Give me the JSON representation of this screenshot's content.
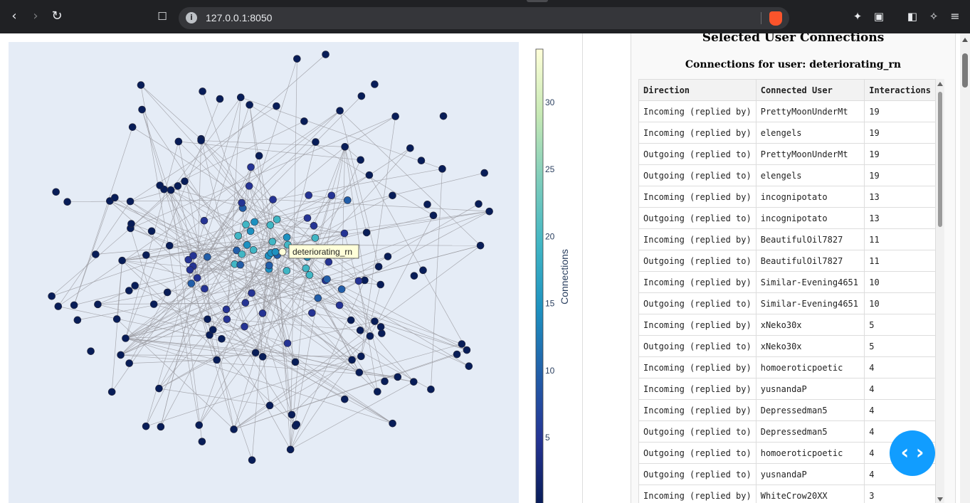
{
  "browser": {
    "url": "127.0.0.1:8050",
    "icons": [
      "back-icon",
      "forward-icon",
      "reload-icon",
      "bookmark-icon",
      "site-info-icon",
      "brave-shield-icon",
      "extensions-icon",
      "screenshot-icon",
      "sidebar-icon",
      "leo-icon",
      "menu-icon"
    ]
  },
  "graph": {
    "hover_label": "deteriorating_rn",
    "colorbar_title": "Connections",
    "colorbar_ticks": [
      "30",
      "25",
      "20",
      "15",
      "10",
      "5"
    ],
    "colorscale": [
      "#ffffd9",
      "#c7e9b4",
      "#7fcdbb",
      "#41b6c4",
      "#1d91c0",
      "#225ea8",
      "#253494",
      "#081d58"
    ]
  },
  "panel": {
    "title": "Selected User Connections",
    "subtitle": "Connections for user: deteriorating_rn",
    "columns": [
      "Direction",
      "Connected User",
      "Interactions"
    ],
    "rows": [
      [
        "Incoming (replied by)",
        "PrettyMoonUnderMt",
        "19"
      ],
      [
        "Incoming (replied by)",
        "elengels",
        "19"
      ],
      [
        "Outgoing (replied to)",
        "PrettyMoonUnderMt",
        "19"
      ],
      [
        "Outgoing (replied to)",
        "elengels",
        "19"
      ],
      [
        "Incoming (replied by)",
        "incognipotato",
        "13"
      ],
      [
        "Outgoing (replied to)",
        "incognipotato",
        "13"
      ],
      [
        "Incoming (replied by)",
        "BeautifulOil7827",
        "11"
      ],
      [
        "Outgoing (replied to)",
        "BeautifulOil7827",
        "11"
      ],
      [
        "Incoming (replied by)",
        "Similar-Evening4651",
        "10"
      ],
      [
        "Outgoing (replied to)",
        "Similar-Evening4651",
        "10"
      ],
      [
        "Incoming (replied by)",
        "xNeko30x",
        "5"
      ],
      [
        "Outgoing (replied to)",
        "xNeko30x",
        "5"
      ],
      [
        "Incoming (replied by)",
        "homoeroticpoetic",
        "4"
      ],
      [
        "Incoming (replied by)",
        "yusnandaP",
        "4"
      ],
      [
        "Incoming (replied by)",
        "Depressedman5",
        "4"
      ],
      [
        "Outgoing (replied to)",
        "Depressedman5",
        "4"
      ],
      [
        "Outgoing (replied to)",
        "homoeroticpoetic",
        "4"
      ],
      [
        "Outgoing (replied to)",
        "yusnandaP",
        "4"
      ],
      [
        "Incoming (replied by)",
        "WhiteCrow20XX",
        "3"
      ]
    ]
  },
  "fab": {
    "icon": "code-brackets-icon",
    "label": "‹ ›"
  }
}
